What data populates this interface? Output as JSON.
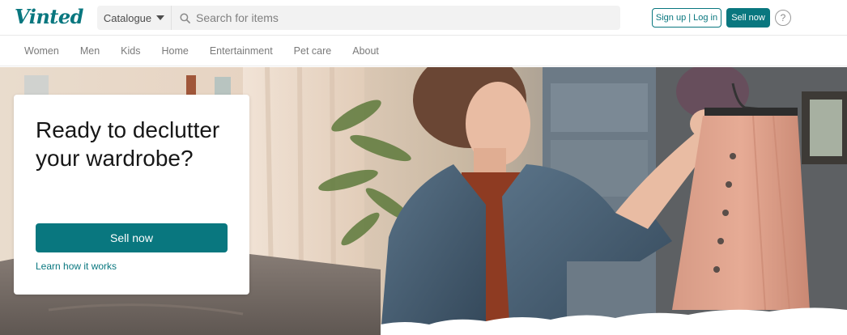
{
  "brand": {
    "logo_text": "Vinted",
    "accent_color": "#09777f"
  },
  "header": {
    "catalogue_label": "Catalogue",
    "search_placeholder": "Search for items",
    "signup_login_label": "Sign up | Log in",
    "sell_now_label": "Sell now",
    "help_icon_glyph": "?"
  },
  "nav": {
    "items": [
      {
        "label": "Women"
      },
      {
        "label": "Men"
      },
      {
        "label": "Kids"
      },
      {
        "label": "Home"
      },
      {
        "label": "Entertainment"
      },
      {
        "label": "Pet care"
      },
      {
        "label": "About"
      }
    ]
  },
  "hero": {
    "title": "Ready to declutter your wardrobe?",
    "sell_button_label": "Sell now",
    "learn_link_label": "Learn how it works",
    "image": "woman holding pink corduroy skirt on hanger"
  },
  "icons": {
    "search": "search-icon",
    "caret": "chevron-down-icon",
    "help": "help-icon"
  }
}
